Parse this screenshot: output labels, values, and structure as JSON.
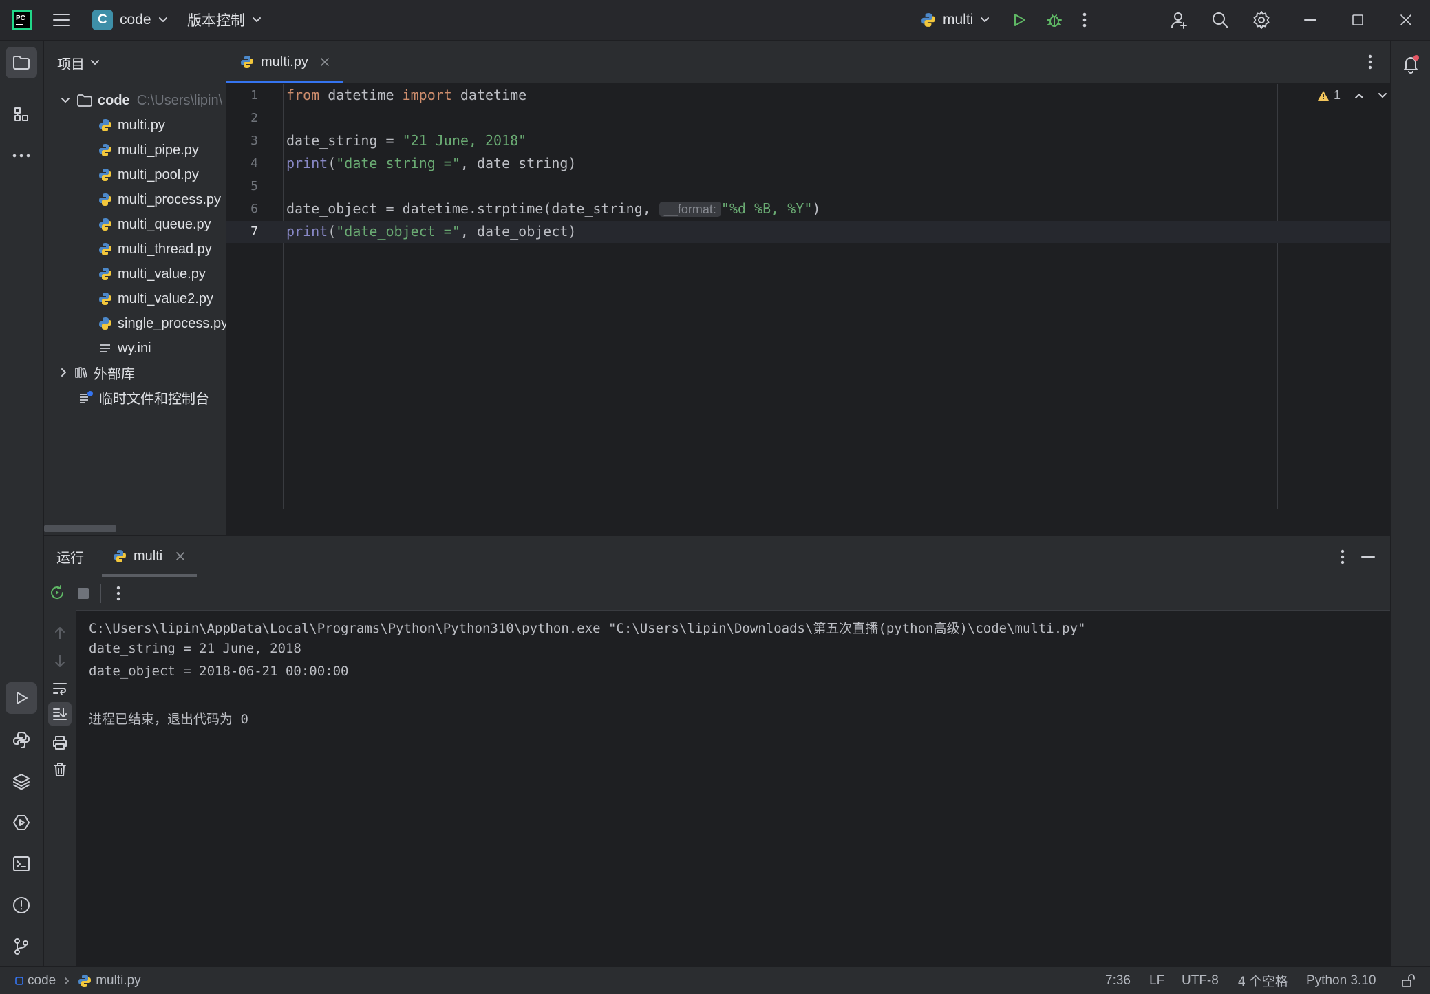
{
  "titlebar": {
    "project_initial": "C",
    "project_name": "code",
    "vcs_label": "版本控制",
    "run_config": "multi"
  },
  "project_panel": {
    "title": "项目",
    "root_name": "code",
    "root_path": "C:\\Users\\lipin\\",
    "files": [
      "multi.py",
      "multi_pipe.py",
      "multi_pool.py",
      "multi_process.py",
      "multi_queue.py",
      "multi_thread.py",
      "multi_value.py",
      "multi_value2.py",
      "single_process.py",
      "wy.ini"
    ],
    "external_libs": "外部库",
    "scratches": "临时文件和控制台"
  },
  "editor": {
    "tab_name": "multi.py",
    "warning_count": "1",
    "line_numbers": [
      "1",
      "2",
      "3",
      "4",
      "5",
      "6",
      "7"
    ],
    "lines": {
      "l1": {
        "kw1": "from",
        "mod": " datetime ",
        "kw2": "import",
        "rest": " datetime"
      },
      "l3": {
        "var": "date_string = ",
        "str": "\"21 June, 2018\""
      },
      "l4": {
        "fn": "print",
        "open": "(",
        "str": "\"date_string =\"",
        "rest": ", date_string)"
      },
      "l6": {
        "pre": "date_object = datetime.strptime(date_string, ",
        "hint": "__format:",
        "str": "\"%d %B, %Y\"",
        "close": ")"
      },
      "l7": {
        "fn": "print",
        "open": "(",
        "str": "\"date_object =\"",
        "rest": ", date_object)"
      }
    }
  },
  "run_panel": {
    "title": "运行",
    "tab_name": "multi",
    "console": [
      "C:\\Users\\lipin\\AppData\\Local\\Programs\\Python\\Python310\\python.exe \"C:\\Users\\lipin\\Downloads\\第五次直播(python高级)\\code\\multi.py\"",
      "date_string = 21 June, 2018",
      "date_object = 2018-06-21 00:00:00",
      "",
      "进程已结束，退出代码为 0"
    ]
  },
  "statusbar": {
    "crumb_project": "code",
    "crumb_file": "multi.py",
    "position": "7:36",
    "line_sep": "LF",
    "encoding": "UTF-8",
    "indent": "4 个空格",
    "interpreter": "Python 3.10"
  },
  "colors": {
    "accent": "#3574f0",
    "run_green": "#5fb865",
    "keyword": "#cf8e6d",
    "string": "#6aab73",
    "builtin": "#8888c6"
  }
}
